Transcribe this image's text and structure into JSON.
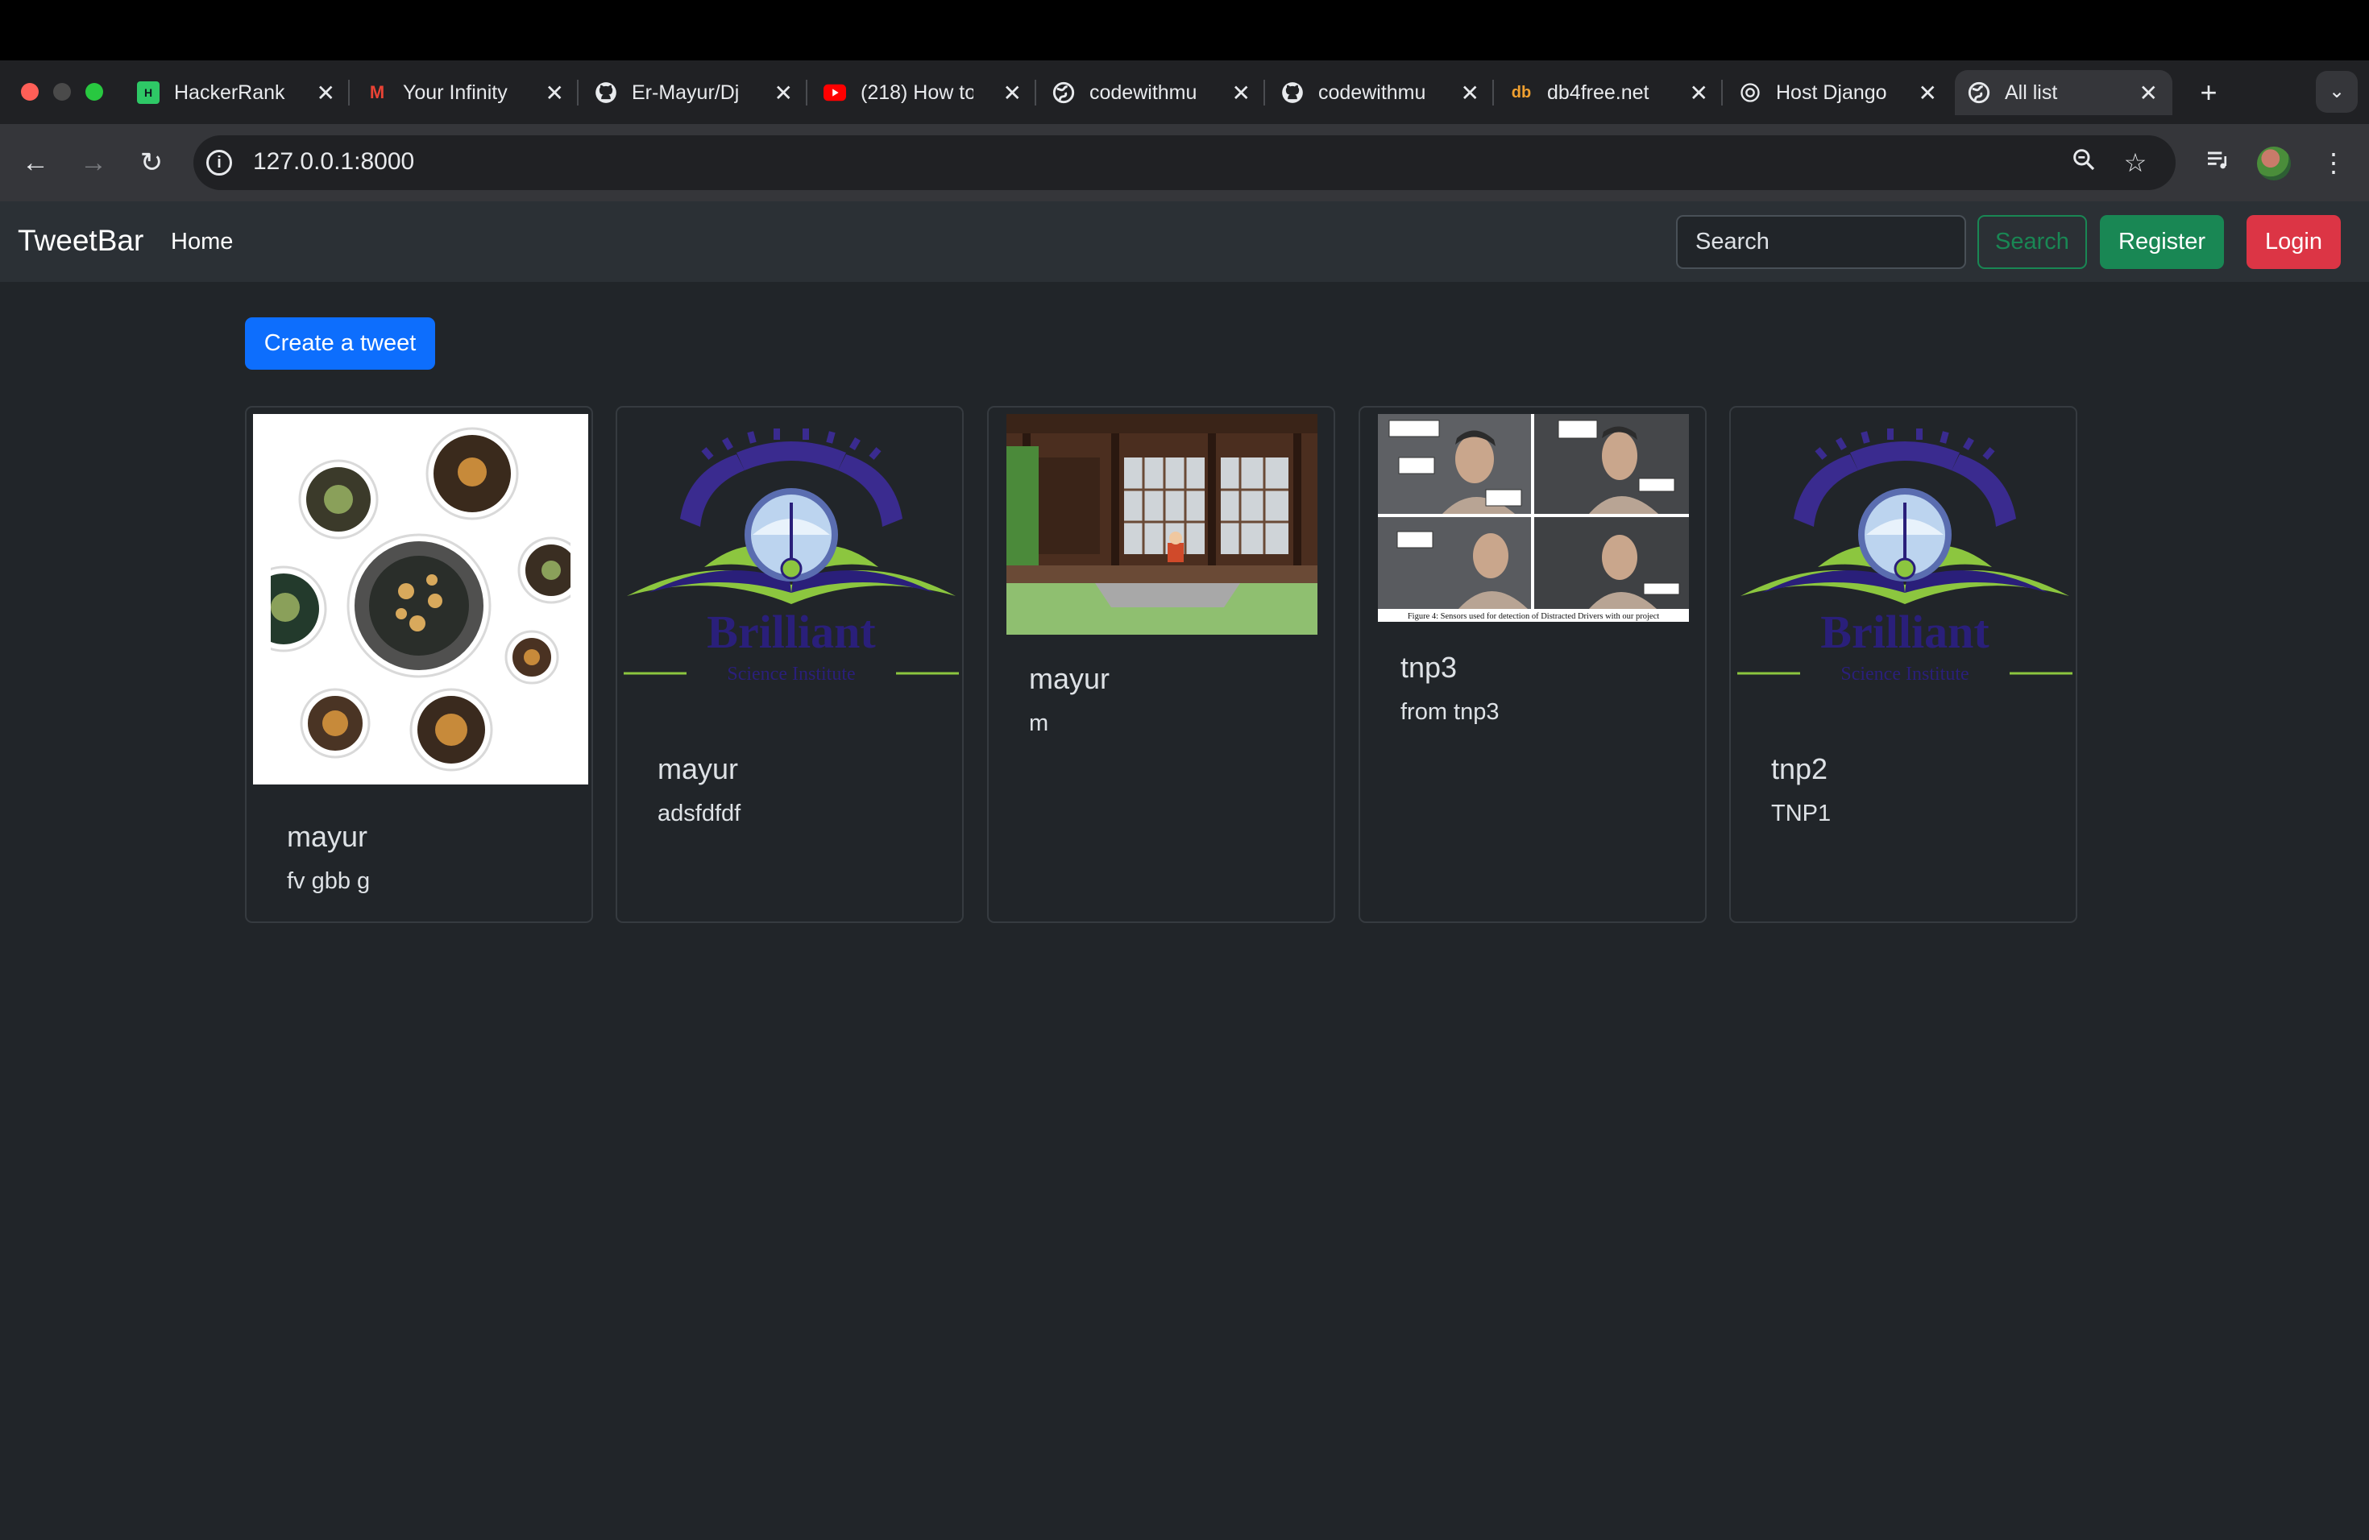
{
  "browser": {
    "tabs": [
      {
        "title": "HackerRank",
        "icon": "hackerrank-icon"
      },
      {
        "title": "Your Infinity",
        "icon": "gmail-icon"
      },
      {
        "title": "Er-Mayur/Dj",
        "icon": "github-icon"
      },
      {
        "title": "(218) How to",
        "icon": "youtube-icon"
      },
      {
        "title": "codewithmu",
        "icon": "globe-icon"
      },
      {
        "title": "codewithmu",
        "icon": "github-icon"
      },
      {
        "title": "db4free.net",
        "icon": "db4free-icon"
      },
      {
        "title": "Host Django",
        "icon": "openai-icon"
      },
      {
        "title": "All list",
        "icon": "globe-icon"
      }
    ],
    "address": "127.0.0.1:8000"
  },
  "navbar": {
    "brand": "TweetBar",
    "home": "Home",
    "search_placeholder": "Search",
    "search_button": "Search",
    "register_button": "Register",
    "login_button": "Login"
  },
  "main": {
    "create_button": "Create a tweet",
    "cards": [
      {
        "title": "mayur",
        "text": "fv gbb g",
        "image": "food-bowls-image"
      },
      {
        "title": "mayur",
        "text": "adsfdfdf",
        "image": "brilliant-logo-image"
      },
      {
        "title": "mayur",
        "text": "m",
        "image": "house-scene-image"
      },
      {
        "title": "tnp3",
        "text": "from tnp3",
        "image": "driver-sensors-figure-image"
      },
      {
        "title": "tnp2",
        "text": "TNP1",
        "image": "brilliant-logo-image"
      }
    ],
    "logo_text": {
      "name": "Brilliant",
      "sub": "Science Institute"
    },
    "figure_caption": "Figure 4: Sensors used for detection of Distracted Drivers with our project"
  },
  "colors": {
    "page_bg": "#212529",
    "navbar_bg": "#2b3035",
    "primary": "#0d6efd",
    "success": "#198754",
    "danger": "#dc3545"
  }
}
